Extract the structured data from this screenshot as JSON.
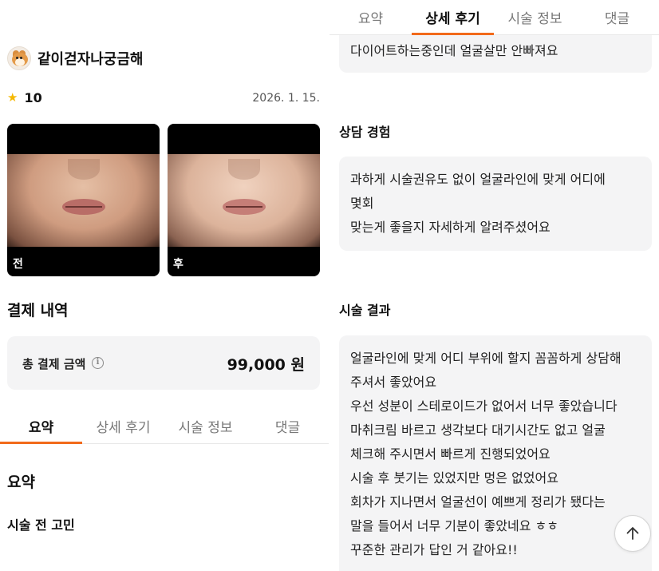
{
  "author": {
    "name": "같이걷자나궁금해"
  },
  "rating": {
    "score": "10",
    "date": "2026. 1. 15."
  },
  "photos": {
    "before_label": "전",
    "after_label": "후"
  },
  "payment": {
    "title": "결제 내역",
    "label": "총 결제 금액",
    "amount": "99,000 원"
  },
  "tabs": [
    "요약",
    "상세 후기",
    "시술 정보",
    "댓글"
  ],
  "tabs_active": {
    "left": "요약",
    "right": "상세 후기"
  },
  "summary": {
    "title": "요약",
    "subtitle": "시술 전 고민"
  },
  "detail": {
    "top_text": "다이어트하는중인데 얼굴살만 안빠져요",
    "consult": {
      "title": "상담 경험",
      "lines": [
        "과하게 시술권유도 없이 얼굴라인에 맞게 어디에",
        "몇회",
        "맞는게 좋을지 자세하게 알려주셨어요"
      ]
    },
    "result": {
      "title": "시술 결과",
      "lines": [
        "얼굴라인에 맞게 어디 부위에 할지 꼼꼼하게 상담해",
        "주셔서 좋았어요",
        "우선 성분이 스테로이드가 없어서 너무 좋았습니다",
        "마취크림 바르고 생각보다 대기시간도 없고 얼굴",
        "체크해 주시면서 빠르게 진행되었어요",
        "시술 후 붓기는 있었지만 멍은 없었어요",
        "회차가 지나면서 얼굴선이 예쁘게 정리가 됐다는",
        "말을 들어서 너무 기분이 좋았네요 ㅎㅎ",
        "꾸준한 관리가 답인 거 같아요!!"
      ]
    }
  },
  "colors": {
    "accent": "#f26a1b",
    "star": "#f5b800",
    "card_bg": "#f4f4f5"
  },
  "icons": {
    "star": "star-icon",
    "info": "info-icon",
    "scroll_top": "arrow-up-icon"
  }
}
